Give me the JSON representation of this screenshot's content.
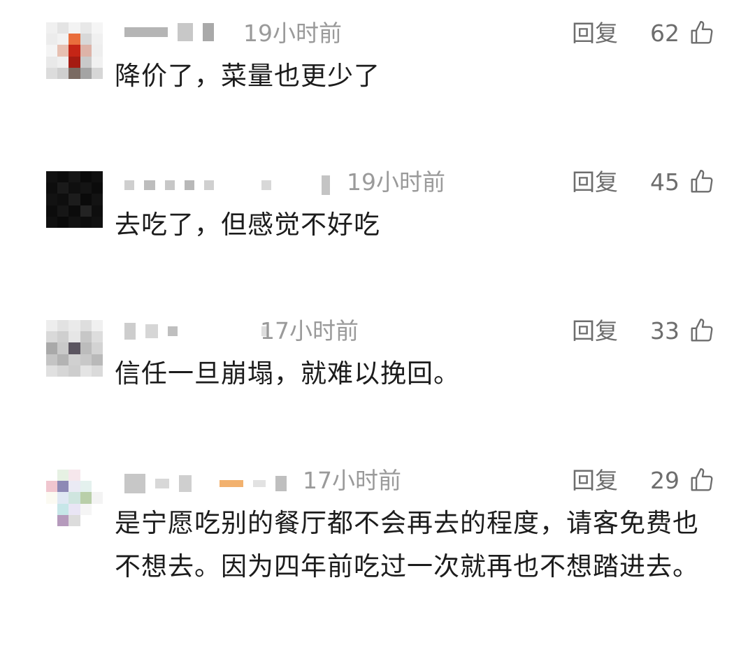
{
  "labels": {
    "reply": "回复"
  },
  "colors": {
    "text": "#1c1c1c",
    "meta": "#9a9a9a",
    "action": "#6d6d6d"
  },
  "comments": [
    {
      "time": "19小时前",
      "likes": "62",
      "text": "降价了，菜量也更少了",
      "avatar": "pixelated-red",
      "icon": "thumbs-up-icon"
    },
    {
      "time": "19小时前",
      "likes": "45",
      "text": "去吃了，但感觉不好吃",
      "avatar": "pixelated-dark",
      "icon": "thumbs-up-icon"
    },
    {
      "time": "17小时前",
      "likes": "33",
      "text": "信任一旦崩塌，就难以挽回。",
      "avatar": "pixelated-gray",
      "icon": "thumbs-up-icon"
    },
    {
      "time": "17小时前",
      "likes": "29",
      "text": "是宁愿吃别的餐厅都不会再去的程度，请客免费也不想去。因为四年前吃过一次就再也不想踏进去。",
      "avatar": "pixelated-pastel",
      "icon": "thumbs-up-icon"
    }
  ]
}
